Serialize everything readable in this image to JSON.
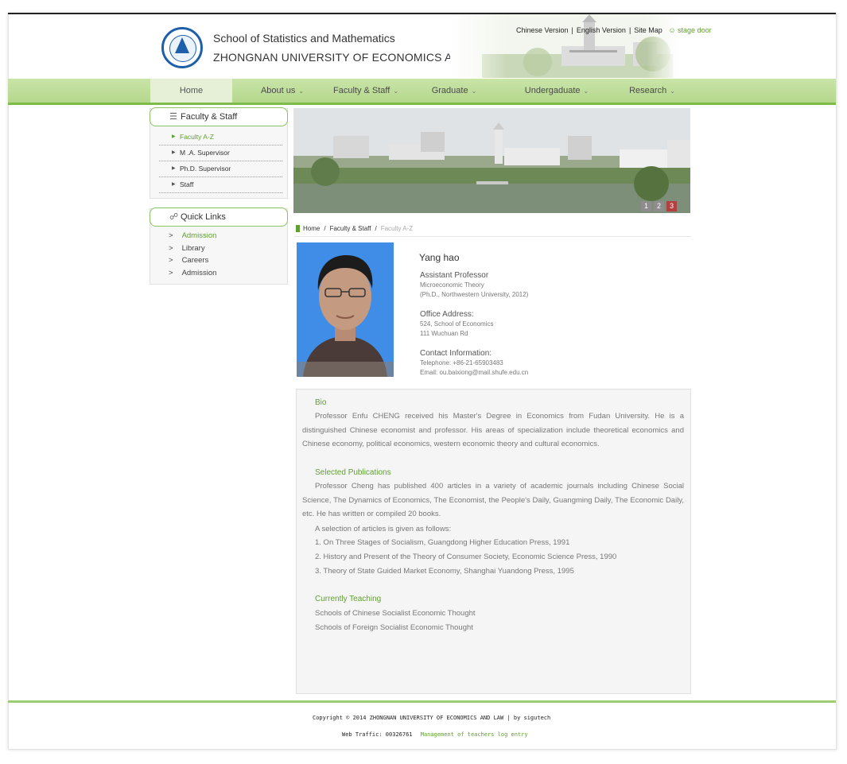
{
  "header": {
    "school_name": "School of Statistics and Mathematics",
    "university_name": "ZHONGNAN UNIVERSITY OF ECONOMICS AND LAW",
    "top_links": {
      "chinese": "Chinese Version",
      "english": "English Version",
      "sitemap": "Site Map",
      "stage_door": "stage door",
      "separator": "|"
    }
  },
  "nav": {
    "items": [
      {
        "label": "Home"
      },
      {
        "label": "About us"
      },
      {
        "label": "Faculty & Staff"
      },
      {
        "label": "Graduate"
      },
      {
        "label": "Undergaduate"
      },
      {
        "label": "Research"
      }
    ],
    "active_index": 0
  },
  "sidebar": {
    "faculty": {
      "title": "Faculty & Staff",
      "items": [
        {
          "label": "Faculty A-Z"
        },
        {
          "label": "M .A.  Supervisor"
        },
        {
          "label": "Ph.D.  Supervisor"
        },
        {
          "label": "Staff"
        }
      ]
    },
    "quick_links": {
      "title": "Quick Links",
      "bullet": ">",
      "items": [
        {
          "label": "Admission"
        },
        {
          "label": "Library"
        },
        {
          "label": "Careers"
        },
        {
          "label": "Admission"
        }
      ]
    }
  },
  "banner": {
    "slides": [
      "1",
      "2",
      "3"
    ],
    "active_slide": 3
  },
  "breadcrumb": {
    "home": "Home",
    "section": "Faculty & Staff",
    "current": "Faculty A-Z",
    "separator": "/"
  },
  "profile": {
    "name": "Yang hao",
    "title": "Assistant Professor",
    "field": "Microeconomic Theory",
    "degree": "(Ph.D., Northwestern University, 2012)",
    "office_heading": "Office Address:",
    "office_line1": "524, School of Economics",
    "office_line2": "111 Wuchuan Rd",
    "contact_heading": "Contact Information:",
    "telephone": "Telephone: +86-21-65903483",
    "email": "Email: ou.baixiong@mail.shufe.edu.cn"
  },
  "bio": {
    "bio_heading": "Bio",
    "bio_text": "Professor Enfu CHENG received his Master's Degree in Economics from Fudan University. He is a distinguished Chinese economist and professor. His areas of specialization include theoretical economics and Chinese economy, political economics, western economic theory and cultural economics.",
    "pub_heading": "Selected Publications",
    "pub_text": "Professor Cheng has published 400 articles in a variety of academic journals including Chinese Social Science, The Dynamics of Economics, The Economist, the People's Daily, Guangming Daily, The Economic Daily, etc. He has written or compiled 20 books.",
    "pub_intro": "A selection of articles is given as follows:",
    "publications": [
      "1. On Three Stages of Socialism, Guangdong Higher Education Press, 1991",
      "2. History and Present of the Theory of Consumer Society, Economic Science Press, 1990",
      "3. Theory of State Guided Market Economy, Shanghai Yuandong Press, 1995"
    ],
    "teaching_heading": "Currently Teaching",
    "teaching": [
      "Schools of Chinese Socialist Economic Thought",
      "Schools of Foreign Socialist Economic Thought"
    ]
  },
  "footer": {
    "copyright": "Copyright © 2014 ZHONGNAN UNIVERSITY OF ECONOMICS AND LAW | by sigutech",
    "traffic_label": "Web Traffic:",
    "traffic_count": "00326761",
    "login_link": "Management of teachers log entry"
  },
  "colors": {
    "accent_green": "#5fa030",
    "nav_green": "#b4d88c",
    "active_slide": "#b24040"
  }
}
